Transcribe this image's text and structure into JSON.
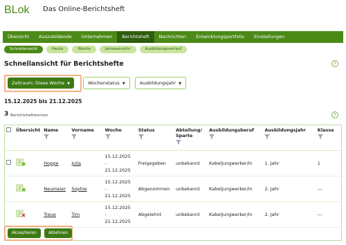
{
  "brand": {
    "logo_text": "BLok",
    "app_title": "Das Online-Berichtsheft"
  },
  "mainnav": {
    "items": [
      "Übersicht",
      "Auszubildende",
      "Unternehmen",
      "Berichtsheft",
      "Nachrichten",
      "Entwicklungsportfolio",
      "Einstellungen"
    ],
    "active": "Berichtsheft"
  },
  "subnav": {
    "items": [
      "Schnellansicht",
      "Heute",
      "Woche",
      "Jahresansicht",
      "Ausbildungsverlauf"
    ],
    "active": "Schnellansicht"
  },
  "page": {
    "title": "Schnellansicht für Berichtshefte",
    "help": "?"
  },
  "filters": {
    "zeitraum": "Zeitraum: Diese Woche",
    "wochenstatus": "Wochenstatus",
    "ausbildungsjahr": "Ausbildungsjahr"
  },
  "range_text": "15.12.2025 bis 21.12.2025",
  "count": {
    "value": "3",
    "label": "Berichtsheftwochen"
  },
  "table": {
    "headers": [
      "Übersicht",
      "Name",
      "Vorname",
      "Woche",
      "Status",
      "Abteilung/ Sparte",
      "Ausbildungsberuf",
      "Ausbildungsjahr",
      "Klasse"
    ],
    "rows": [
      {
        "name": "Hoppe",
        "vorname": "Julia",
        "woche_start": "15.12.2025",
        "woche_sep": "-",
        "woche_end": "21.12.2025",
        "status": "Freigegeben",
        "abteilung": "unbekannt",
        "beruf": "Kabeljungwerker/in",
        "jahr": "1. Jahr",
        "klasse": "1",
        "icon": "report-submitted-icon",
        "checkbox": true
      },
      {
        "name": "Neumeier",
        "vorname": "Sophie",
        "woche_start": "15.12.2025",
        "woche_sep": "-",
        "woche_end": "21.12.2025",
        "status": "Abgenommen",
        "abteilung": "unbekannt",
        "beruf": "Kabeljungwerker/in",
        "jahr": "2. Jahr",
        "klasse": "---",
        "icon": "report-accepted-icon",
        "checkbox": false
      },
      {
        "name": "Treue",
        "vorname": "Tim",
        "woche_start": "15.12.2025",
        "woche_sep": "-",
        "woche_end": "21.12.2025",
        "status": "Abgelehnt",
        "abteilung": "unbekannt",
        "beruf": "Kabeljungwerker/in",
        "jahr": "2. Jahr",
        "klasse": "---",
        "icon": "report-rejected-icon",
        "checkbox": false
      }
    ]
  },
  "actions": {
    "accept": "Akzeptieren",
    "reject": "Ablehnen"
  },
  "colors": {
    "brand_green": "#4c8a18",
    "active_green": "#2f5e0c",
    "pill_light": "#c8e5a0",
    "highlight": "#f4b083"
  }
}
